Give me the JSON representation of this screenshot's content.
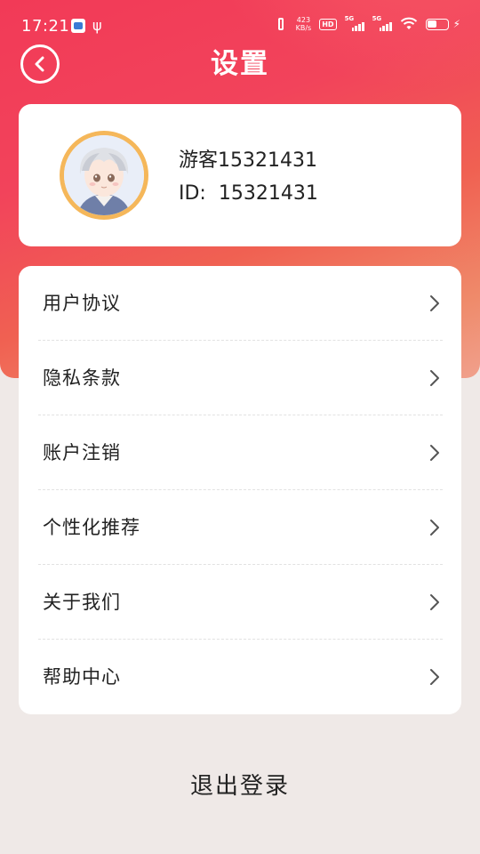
{
  "status_bar": {
    "time": "17:21",
    "net_speed_value": "423",
    "net_speed_unit": "KB/s",
    "hd_label": "HD",
    "sim1_label": "5G",
    "sim2_label": "5G"
  },
  "header": {
    "title": "设置"
  },
  "profile": {
    "name": "游客15321431",
    "id_label": "ID:",
    "id_value": "15321431"
  },
  "menu": {
    "items": [
      {
        "label": "用户协议"
      },
      {
        "label": "隐私条款"
      },
      {
        "label": "账户注销"
      },
      {
        "label": "个性化推荐"
      },
      {
        "label": "关于我们"
      },
      {
        "label": "帮助中心"
      }
    ]
  },
  "logout": {
    "label": "退出登录"
  },
  "colors": {
    "gradient_start": "#f23a57",
    "gradient_end": "#f0a08c",
    "page_bg": "#efe9e7",
    "avatar_ring": "#f5b75a"
  }
}
